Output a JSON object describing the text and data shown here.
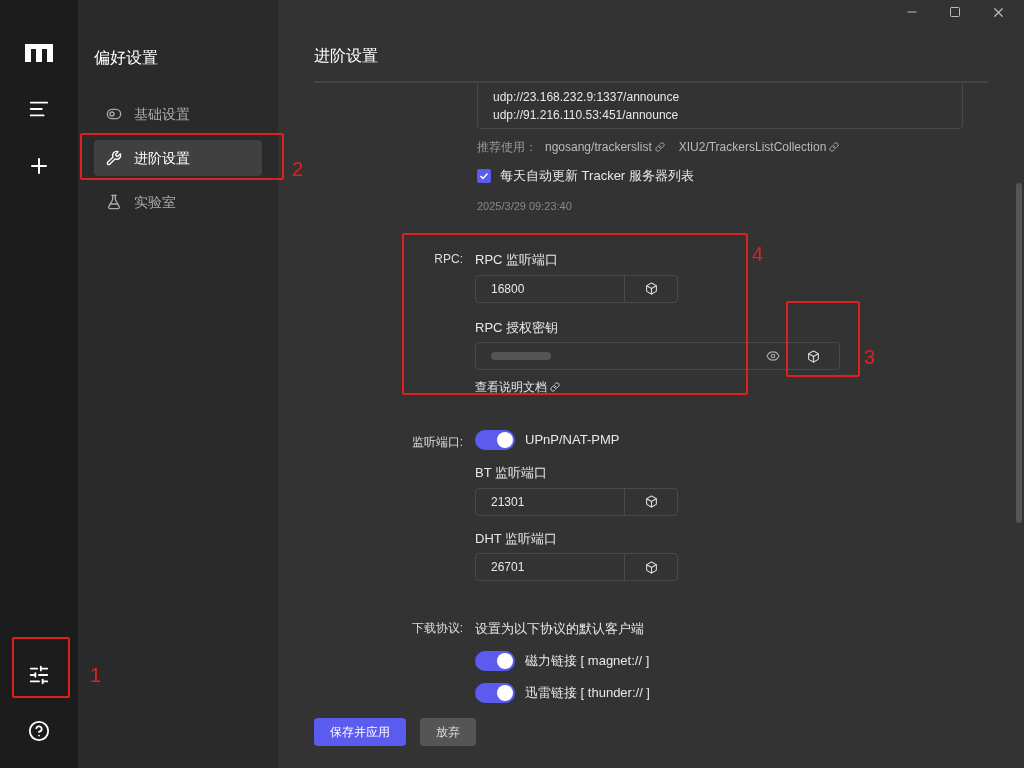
{
  "sidebar": {
    "title": "偏好设置",
    "items": [
      {
        "label": "基础设置",
        "selected": false,
        "kind": "basic"
      },
      {
        "label": "进阶设置",
        "selected": true,
        "kind": "advanced"
      },
      {
        "label": "实验室",
        "selected": false,
        "kind": "lab"
      }
    ]
  },
  "page": {
    "title": "进阶设置"
  },
  "trackers": {
    "lines": [
      "udp://23.168.232.9:1337/announce",
      "udp://91.216.110.53:451/announce"
    ],
    "recommend_label": "推荐使用：",
    "links": [
      "ngosang/trackerslist",
      "XIU2/TrackersListCollection"
    ],
    "auto_update": {
      "label": "每天自动更新 Tracker 服务器列表",
      "checked": true
    },
    "last_update": "2025/3/29 09:23:40"
  },
  "rpc": {
    "label": "RPC:",
    "port_label": "RPC 监听端口",
    "port": "16800",
    "secret_label": "RPC 授权密钥",
    "doc_link": "查看说明文档"
  },
  "listen": {
    "label": "监听端口:",
    "upnp": {
      "label": "UPnP/NAT-PMP",
      "on": true
    },
    "ports": [
      {
        "label": "BT 监听端口",
        "value": "21301"
      },
      {
        "label": "DHT 监听端口",
        "value": "26701"
      }
    ]
  },
  "protocols": {
    "label": "下载协议:",
    "hint": "设置为以下协议的默认客户端",
    "items": [
      {
        "label": "磁力链接 [ magnet:// ]",
        "on": true
      },
      {
        "label": "迅雷链接 [ thunder:// ]",
        "on": true
      }
    ]
  },
  "buttons": [
    {
      "label": "保存并应用",
      "kind": "primary"
    },
    {
      "label": "放弃",
      "kind": "secondary"
    }
  ],
  "annotations": [
    {
      "number": "1"
    },
    {
      "number": "2"
    },
    {
      "number": "3"
    },
    {
      "number": "4"
    }
  ]
}
